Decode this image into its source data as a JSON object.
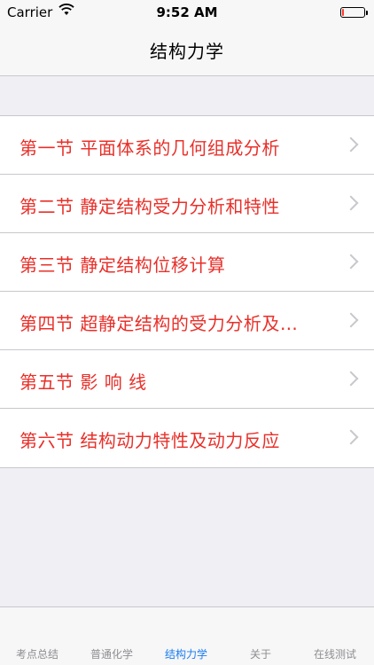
{
  "status_bar": {
    "carrier": "Carrier",
    "time": "9:52 AM",
    "battery_level_percent": 10
  },
  "nav": {
    "title": "结构力学"
  },
  "list": {
    "items": [
      {
        "label": "第一节  平面体系的几何组成分析"
      },
      {
        "label": "第二节  静定结构受力分析和特性"
      },
      {
        "label": "第三节  静定结构位移计算"
      },
      {
        "label": "第四节  超静定结构的受力分析及…"
      },
      {
        "label": "第五节  影  响  线"
      },
      {
        "label": "第六节  结构动力特性及动力反应"
      }
    ]
  },
  "tabs": {
    "items": [
      {
        "label": "考点总结"
      },
      {
        "label": "普通化学"
      },
      {
        "label": "结构力学",
        "active": true
      },
      {
        "label": "关于"
      },
      {
        "label": "在线测试"
      }
    ]
  },
  "colors": {
    "accent": "#1a7cf0",
    "item_text": "#e8302a"
  }
}
